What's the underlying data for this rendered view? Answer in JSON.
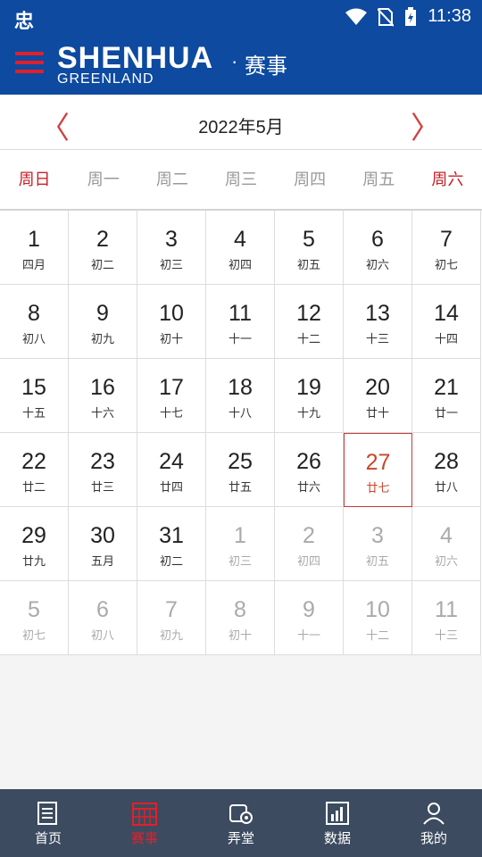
{
  "status_bar": {
    "app_icon": "忠",
    "time": "11:38"
  },
  "header": {
    "logo_main": "SHENHUA",
    "logo_sub": "GREENLAND",
    "logo_dot": "·",
    "logo_cn": "赛事"
  },
  "calendar": {
    "prev_arrow": "〈",
    "next_arrow": "〉",
    "month_title": "2022年5月",
    "weekdays": [
      "周日",
      "周一",
      "周二",
      "周三",
      "周四",
      "周五",
      "周六"
    ],
    "days": [
      {
        "n": "1",
        "l": "四月",
        "s": ""
      },
      {
        "n": "2",
        "l": "初二",
        "s": ""
      },
      {
        "n": "3",
        "l": "初三",
        "s": ""
      },
      {
        "n": "4",
        "l": "初四",
        "s": ""
      },
      {
        "n": "5",
        "l": "初五",
        "s": ""
      },
      {
        "n": "6",
        "l": "初六",
        "s": ""
      },
      {
        "n": "7",
        "l": "初七",
        "s": ""
      },
      {
        "n": "8",
        "l": "初八",
        "s": ""
      },
      {
        "n": "9",
        "l": "初九",
        "s": ""
      },
      {
        "n": "10",
        "l": "初十",
        "s": ""
      },
      {
        "n": "11",
        "l": "十一",
        "s": ""
      },
      {
        "n": "12",
        "l": "十二",
        "s": ""
      },
      {
        "n": "13",
        "l": "十三",
        "s": ""
      },
      {
        "n": "14",
        "l": "十四",
        "s": ""
      },
      {
        "n": "15",
        "l": "十五",
        "s": ""
      },
      {
        "n": "16",
        "l": "十六",
        "s": ""
      },
      {
        "n": "17",
        "l": "十七",
        "s": ""
      },
      {
        "n": "18",
        "l": "十八",
        "s": ""
      },
      {
        "n": "19",
        "l": "十九",
        "s": ""
      },
      {
        "n": "20",
        "l": "廿十",
        "s": ""
      },
      {
        "n": "21",
        "l": "廿一",
        "s": ""
      },
      {
        "n": "22",
        "l": "廿二",
        "s": ""
      },
      {
        "n": "23",
        "l": "廿三",
        "s": ""
      },
      {
        "n": "24",
        "l": "廿四",
        "s": ""
      },
      {
        "n": "25",
        "l": "廿五",
        "s": ""
      },
      {
        "n": "26",
        "l": "廿六",
        "s": ""
      },
      {
        "n": "27",
        "l": "廿七",
        "s": "today"
      },
      {
        "n": "28",
        "l": "廿八",
        "s": ""
      },
      {
        "n": "29",
        "l": "廿九",
        "s": ""
      },
      {
        "n": "30",
        "l": "五月",
        "s": ""
      },
      {
        "n": "31",
        "l": "初二",
        "s": ""
      },
      {
        "n": "1",
        "l": "初三",
        "s": "other"
      },
      {
        "n": "2",
        "l": "初四",
        "s": "other"
      },
      {
        "n": "3",
        "l": "初五",
        "s": "other"
      },
      {
        "n": "4",
        "l": "初六",
        "s": "other"
      },
      {
        "n": "5",
        "l": "初七",
        "s": "other"
      },
      {
        "n": "6",
        "l": "初八",
        "s": "other"
      },
      {
        "n": "7",
        "l": "初九",
        "s": "other"
      },
      {
        "n": "8",
        "l": "初十",
        "s": "other"
      },
      {
        "n": "9",
        "l": "十一",
        "s": "other"
      },
      {
        "n": "10",
        "l": "十二",
        "s": "other"
      },
      {
        "n": "11",
        "l": "十三",
        "s": "other"
      }
    ]
  },
  "tabs": [
    {
      "label": "首页",
      "icon": "document-icon",
      "active": false
    },
    {
      "label": "赛事",
      "icon": "calendar-icon",
      "active": true
    },
    {
      "label": "弄堂",
      "icon": "chat-gear-icon",
      "active": false
    },
    {
      "label": "数据",
      "icon": "bar-chart-icon",
      "active": false
    },
    {
      "label": "我的",
      "icon": "user-icon",
      "active": false
    }
  ],
  "colors": {
    "brand_blue": "#0d4aa0",
    "accent_red": "#c8202a",
    "tabbar": "#3c4b5f"
  }
}
